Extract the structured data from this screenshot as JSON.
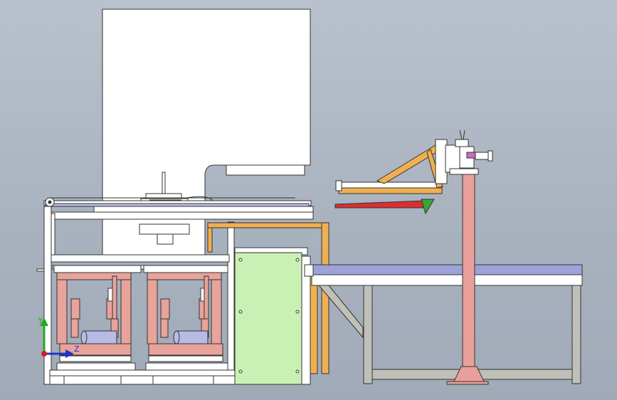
{
  "viewport": {
    "background_top": "#b9c1cc",
    "background_bottom": "#a1aab8"
  },
  "triad": {
    "y_label": "Y",
    "z_label": "Z",
    "y_color": "#22aa22",
    "z_color": "#2233cc",
    "x_color": "#cc2222"
  },
  "colors": {
    "press_body": "#ffffff",
    "frame_line": "#333333",
    "fixture_red": "#e8a39b",
    "guard_green": "#c9f1b4",
    "belt_blue": "#9da2d9",
    "table_leg": "#bfc0b8",
    "post_pink": "#e9a09a",
    "aluminium_orange": "#f0b050",
    "arm_red": "#d83030",
    "arm_green": "#34a834",
    "motor_blue": "#b7bbe6"
  }
}
